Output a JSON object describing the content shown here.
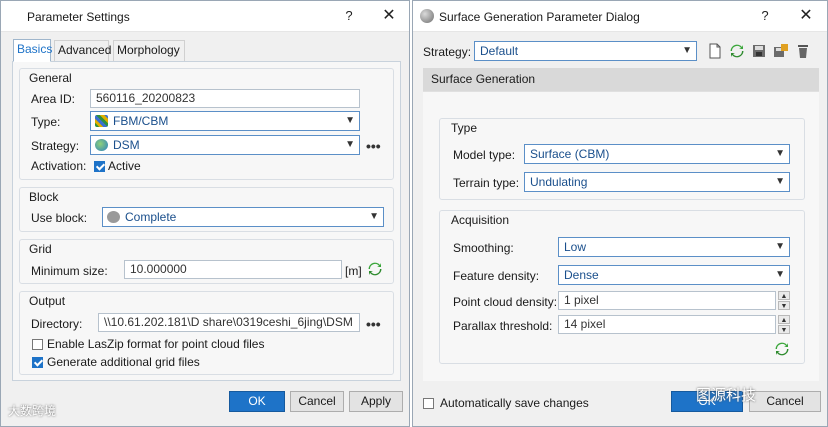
{
  "param_dialog": {
    "title": "Parameter Settings",
    "help": "?",
    "close": "✕",
    "tabs": [
      "Basics",
      "Advanced",
      "Morphology"
    ],
    "general": {
      "title": "General",
      "area_id_label": "Area ID:",
      "area_id_value": "560116_20200823",
      "type_label": "Type:",
      "type_value": "FBM/CBM",
      "strategy_label": "Strategy:",
      "strategy_value": "DSM",
      "activation_label": "Activation:",
      "active_label": "Active",
      "active_checked": true
    },
    "block": {
      "title": "Block",
      "use_block_label": "Use block:",
      "use_block_value": "Complete"
    },
    "grid": {
      "title": "Grid",
      "min_size_label": "Minimum size:",
      "min_size_value": "10.000000",
      "unit": "[m]"
    },
    "output": {
      "title": "Output",
      "directory_label": "Directory:",
      "directory_value": "\\\\10.61.202.181\\D share\\0319ceshi_6jing\\DSM",
      "laszip_label": "Enable LasZip format for point cloud files",
      "laszip_checked": false,
      "grid_files_label": "Generate additional grid files",
      "grid_files_checked": true
    },
    "buttons": {
      "ok": "OK",
      "cancel": "Cancel",
      "apply": "Apply"
    },
    "more": "•••"
  },
  "surface_dialog": {
    "title": "Surface Generation Parameter Dialog",
    "help": "?",
    "close": "✕",
    "strategy_label": "Strategy:",
    "strategy_value": "Default",
    "section_header": "Surface Generation",
    "type_group": {
      "title": "Type",
      "model_type_label": "Model type:",
      "model_type_value": "Surface (CBM)",
      "terrain_type_label": "Terrain type:",
      "terrain_type_value": "Undulating"
    },
    "acquisition_group": {
      "title": "Acquisition",
      "smoothing_label": "Smoothing:",
      "smoothing_value": "Low",
      "feature_density_label": "Feature density:",
      "feature_density_value": "Dense",
      "point_cloud_label": "Point cloud density:",
      "point_cloud_value": "1 pixel",
      "parallax_label": "Parallax threshold:",
      "parallax_value": "14 pixel"
    },
    "auto_save_label": "Automatically save changes",
    "auto_save_checked": false,
    "buttons": {
      "ok": "OK",
      "cancel": "Cancel"
    }
  },
  "watermarks": {
    "left": "大数跨境",
    "right": "图源科技"
  },
  "colors": {
    "accent": "#1e73c8",
    "refresh_green": "#3aa63a",
    "section_header": "#d9d9d9"
  }
}
